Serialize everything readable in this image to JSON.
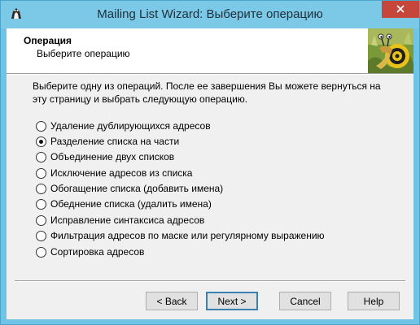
{
  "window": {
    "title": "Mailing List Wizard: Выберите операцию"
  },
  "header": {
    "title": "Операция",
    "subtitle": "Выберите операцию"
  },
  "intro_text": "Выберите одну из операций. После ее завершения Вы можете вернуться на эту страницу и выбрать следующую операцию.",
  "options": [
    {
      "label": "Удаление дублирующихся адресов",
      "checked": false
    },
    {
      "label": "Разделение списка на части",
      "checked": true
    },
    {
      "label": "Объединение двух списков",
      "checked": false
    },
    {
      "label": "Исключение адресов из списка",
      "checked": false
    },
    {
      "label": "Обогащение списка (добавить имена)",
      "checked": false
    },
    {
      "label": "Обеднение списка (удалить имена)",
      "checked": false
    },
    {
      "label": "Исправление синтаксиса адресов",
      "checked": false
    },
    {
      "label": "Фильтрация адресов по маске или регулярному выражению",
      "checked": false
    },
    {
      "label": "Сортировка адресов",
      "checked": false
    }
  ],
  "buttons": {
    "back": "< Back",
    "next": "Next >",
    "cancel": "Cancel",
    "help": "Help"
  },
  "colors": {
    "titlebar": "#7cc8e7",
    "close_button": "#c7463c",
    "dialog_background": "#f0f0f0"
  }
}
